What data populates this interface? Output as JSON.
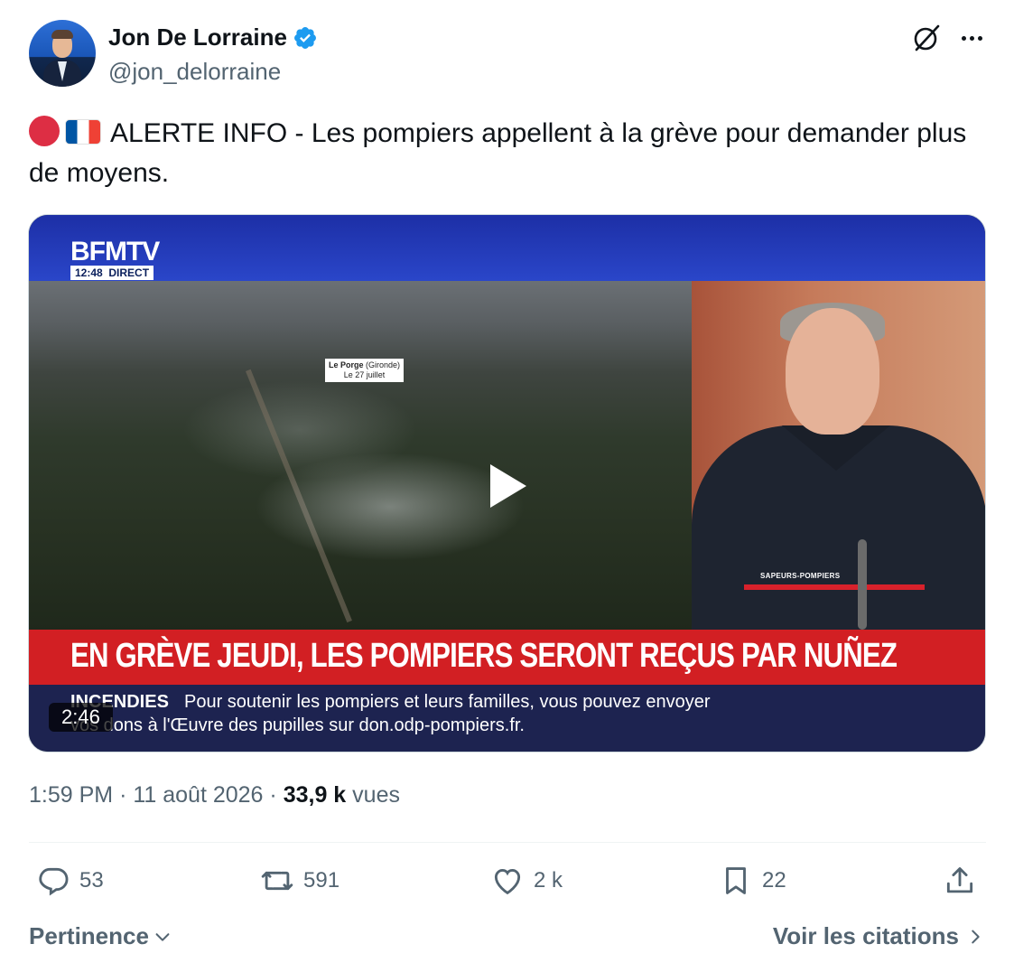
{
  "author": {
    "display_name": "Jon De Lorraine",
    "handle": "@jon_delorraine",
    "verified": true
  },
  "tweet": {
    "text": "ALERTE INFO - Les pompiers appellent à la grève pour demander plus de moyens.",
    "emojis": [
      "red-circle",
      "flag-france"
    ]
  },
  "media": {
    "channel_logo": "BFMTV",
    "channel_time": "12:48",
    "channel_live": "DIRECT",
    "location_name": "Le Porge",
    "location_region": "(Gironde)",
    "location_date": "Le 27 juillet",
    "uniform_label": "SAPEURS-POMPIERS",
    "headline": "EN GRÈVE JEUDI, LES POMPIERS SERONT REÇUS PAR NUÑEZ",
    "ticker_tag": "INCENDIES",
    "ticker_line1": "Pour soutenir les pompiers et leurs familles, vous pouvez envoyer",
    "ticker_line2": "vos dons à l'Œuvre des pupilles sur don.odp-pompiers.fr.",
    "duration": "2:46"
  },
  "meta": {
    "time": "1:59 PM",
    "separator": "·",
    "date": "11 août 2026",
    "views_count": "33,9 k",
    "views_label": "vues"
  },
  "actions": {
    "replies": "53",
    "retweets": "591",
    "likes": "2 k",
    "bookmarks": "22"
  },
  "footer": {
    "sort_label": "Pertinence",
    "quotes_label": "Voir les citations"
  },
  "colors": {
    "text_primary": "#0f1419",
    "text_secondary": "#536471",
    "verified_blue": "#1d9bf0",
    "headline_red": "#d21f23",
    "bfm_blue": "#2a46c9"
  }
}
